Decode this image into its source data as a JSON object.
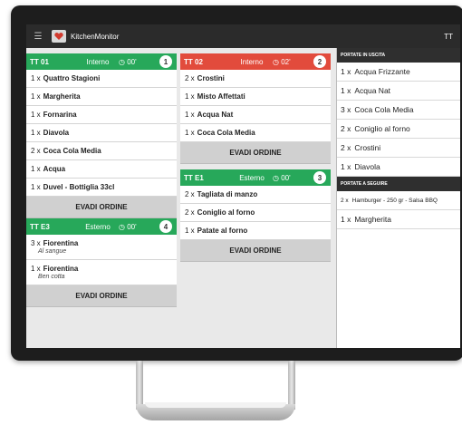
{
  "app": {
    "title": "KitchenMonitor",
    "user": "TT",
    "menu_icon": "hamburger-menu-icon",
    "logo_icon": "kitchen-logo-icon"
  },
  "colors": {
    "green": "#27a85a",
    "red": "#e24b3c",
    "dark": "#2b2b2b",
    "button": "#d0d0d0"
  },
  "tickets": [
    {
      "table": "TT 01",
      "type": "Interno",
      "time": "◷ 00'",
      "number": "1",
      "items": [
        {
          "qty": "1 x",
          "name": "Quattro Stagioni"
        },
        {
          "qty": "1 x",
          "name": "Margherita"
        },
        {
          "qty": "1 x",
          "name": "Fornarina"
        },
        {
          "qty": "1 x",
          "name": "Diavola"
        },
        {
          "qty": "2 x",
          "name": "Coca Cola Media"
        },
        {
          "qty": "1 x",
          "name": "Acqua"
        },
        {
          "qty": "1 x",
          "name": "Duvel - Bottiglia 33cl"
        }
      ],
      "button": "EVADI ORDINE"
    },
    {
      "table": "TT E3",
      "type": "Esterno",
      "time": "◷ 00'",
      "number": "4",
      "items": [
        {
          "qty": "3 x",
          "name": "Fiorentina",
          "note": "Al sangue"
        },
        {
          "qty": "1 x",
          "name": "Fiorentina",
          "note": "Ben cotta"
        }
      ],
      "button": "EVADI ORDINE"
    },
    {
      "table": "TT 02",
      "type": "Interno",
      "time": "◷ 02'",
      "number": "2",
      "items": [
        {
          "qty": "2 x",
          "name": "Crostini"
        },
        {
          "qty": "1 x",
          "name": "Misto Affettati"
        },
        {
          "qty": "1 x",
          "name": "Acqua Nat"
        },
        {
          "qty": "1 x",
          "name": "Coca Cola Media"
        }
      ],
      "button": "EVADI ORDINE"
    },
    {
      "table": "TT E1",
      "type": "Esterno",
      "time": "◷ 00'",
      "number": "3",
      "items": [
        {
          "qty": "2 x",
          "name": "Tagliata di manzo"
        },
        {
          "qty": "2 x",
          "name": "Coniglio al forno"
        },
        {
          "qty": "1 x",
          "name": "Patate al forno"
        }
      ],
      "button": "EVADI ORDINE"
    }
  ],
  "panel": {
    "uscita_title": "PORTATE IN USCITA",
    "uscita": [
      {
        "qty": "1 x",
        "name": "Acqua Frizzante"
      },
      {
        "qty": "1 x",
        "name": "Acqua Nat"
      },
      {
        "qty": "3 x",
        "name": "Coca Cola Media"
      },
      {
        "qty": "2 x",
        "name": "Coniglio al forno"
      },
      {
        "qty": "2 x",
        "name": "Crostini"
      },
      {
        "qty": "1 x",
        "name": "Diavola"
      }
    ],
    "seguire_title": "PORTATE A SEGUIRE",
    "seguire": [
      {
        "qty": "2 x",
        "name": "Hamburger - 250 gr - Salsa BBQ"
      },
      {
        "qty": "1 x",
        "name": "Margherita"
      }
    ]
  }
}
